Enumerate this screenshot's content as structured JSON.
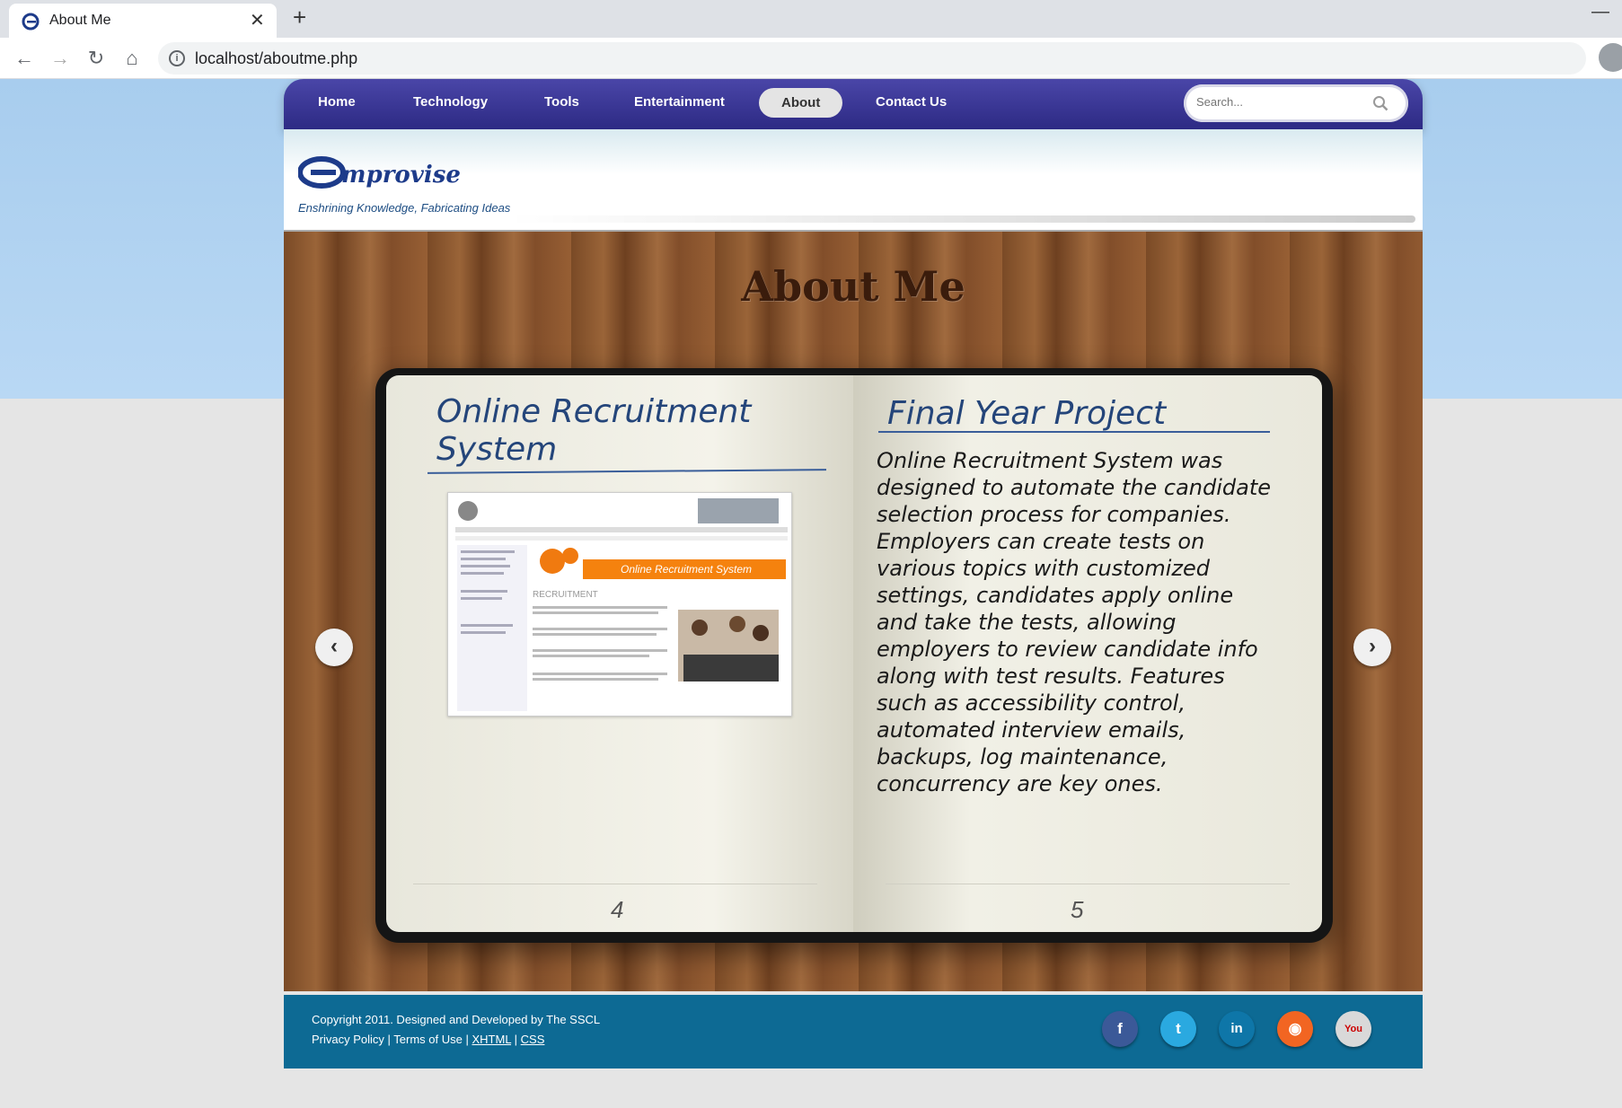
{
  "browser": {
    "tab_title": "About Me",
    "tab_close": "✕",
    "new_tab": "+",
    "minimize": "—",
    "url": "localhost/aboutme.php",
    "back": "←",
    "forward": "→",
    "reload": "↻",
    "home": "⌂"
  },
  "nav": {
    "items": [
      "Home",
      "Technology",
      "Tools",
      "Entertainment",
      "About",
      "Contact Us"
    ],
    "active": "About",
    "search_placeholder": "Search..."
  },
  "header": {
    "logo_text": "Emprovise",
    "tagline": "Enshrining Knowledge, Fabricating Ideas"
  },
  "content": {
    "title": "About Me",
    "left_page": {
      "title": "Online Recruitment System",
      "page_number": "4",
      "screenshot_banner": "Online Recruitment System",
      "screenshot_heading": "RECRUITMENT"
    },
    "right_page": {
      "title": "Final Year Project",
      "description": "Online Recruitment System was designed to automate the candidate selection process for companies. Employers can create tests on various topics with customized settings, candidates apply online and take the tests, allowing employers to review candidate info along with test results. Features such as accessibility control, automated interview emails, backups, log maintenance, concurrency are key ones.",
      "page_number": "5"
    },
    "prev_arrow": "‹",
    "next_arrow": "›"
  },
  "footer": {
    "copyright": "Copyright 2011. Designed and Developed by The SSCL",
    "links": [
      "Privacy Policy",
      "Terms of Use",
      "XHTML",
      "CSS"
    ],
    "social": [
      {
        "name": "facebook",
        "glyph": "f",
        "color": "#3b5998"
      },
      {
        "name": "twitter",
        "glyph": "t",
        "color": "#2aa9e0"
      },
      {
        "name": "linkedin",
        "glyph": "in",
        "color": "#0e76a8"
      },
      {
        "name": "rss",
        "glyph": "◉",
        "color": "#f26522"
      },
      {
        "name": "youtube",
        "glyph": "You",
        "color": "#d9d9d9"
      }
    ]
  }
}
